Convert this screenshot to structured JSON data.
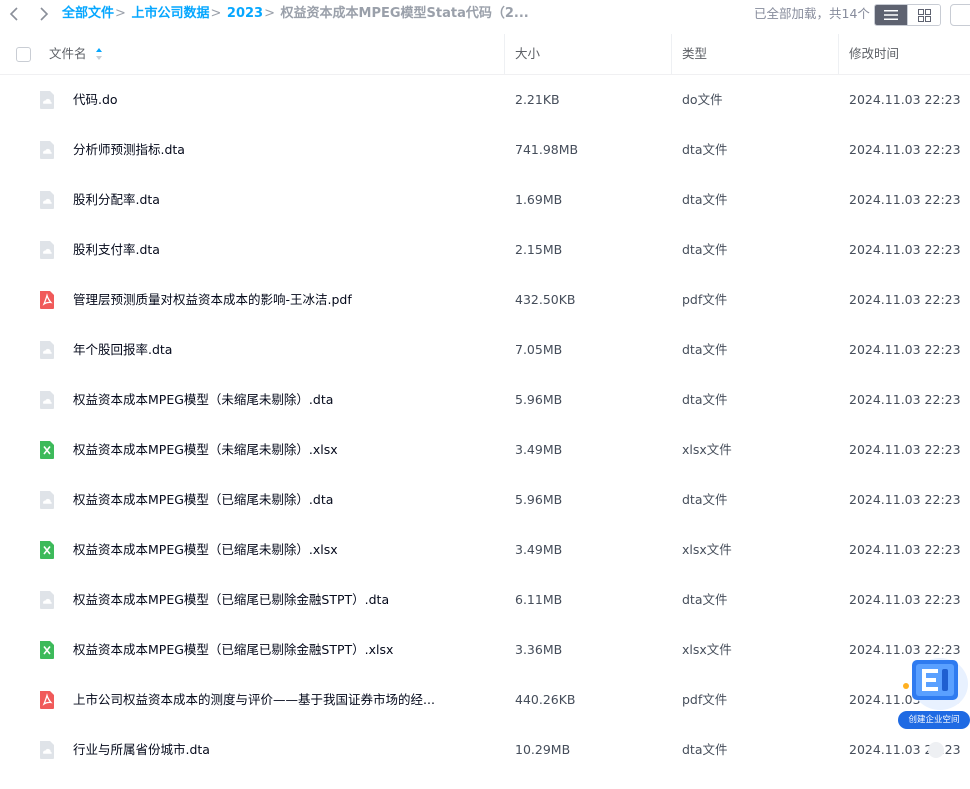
{
  "nav": {
    "back_icon": "chevron-left-icon",
    "forward_icon": "chevron-right-icon"
  },
  "breadcrumb": {
    "items": [
      "全部文件",
      "上市公司数据",
      "2023"
    ],
    "current": "权益资本成本MPEG模型Stata代码（2...",
    "separator": ">"
  },
  "status": {
    "loaded_text": "已全部加载，共14个"
  },
  "view": {
    "active": "list",
    "list_icon": "list-view-icon",
    "grid_icon": "grid-view-icon"
  },
  "table": {
    "headers": {
      "name": "文件名",
      "size": "大小",
      "type": "类型",
      "modified": "修改时间"
    },
    "sort": {
      "column": "name",
      "direction": "asc"
    },
    "rows": [
      {
        "icon": "file-icon",
        "name": "代码.do",
        "size": "2.21KB",
        "type": "do文件",
        "modified": "2024.11.03 22:23"
      },
      {
        "icon": "file-icon",
        "name": "分析师预测指标.dta",
        "size": "741.98MB",
        "type": "dta文件",
        "modified": "2024.11.03 22:23"
      },
      {
        "icon": "file-icon",
        "name": "股利分配率.dta",
        "size": "1.69MB",
        "type": "dta文件",
        "modified": "2024.11.03 22:23"
      },
      {
        "icon": "file-icon",
        "name": "股利支付率.dta",
        "size": "2.15MB",
        "type": "dta文件",
        "modified": "2024.11.03 22:23"
      },
      {
        "icon": "pdf-icon",
        "name": "管理层预测质量对权益资本成本的影响-王冰洁.pdf",
        "size": "432.50KB",
        "type": "pdf文件",
        "modified": "2024.11.03 22:23"
      },
      {
        "icon": "file-icon",
        "name": "年个股回报率.dta",
        "size": "7.05MB",
        "type": "dta文件",
        "modified": "2024.11.03 22:23"
      },
      {
        "icon": "file-icon",
        "name": "权益资本成本MPEG模型（未缩尾未剔除）.dta",
        "size": "5.96MB",
        "type": "dta文件",
        "modified": "2024.11.03 22:23"
      },
      {
        "icon": "excel-icon",
        "name": "权益资本成本MPEG模型（未缩尾未剔除）.xlsx",
        "size": "3.49MB",
        "type": "xlsx文件",
        "modified": "2024.11.03 22:23"
      },
      {
        "icon": "file-icon",
        "name": "权益资本成本MPEG模型（已缩尾未剔除）.dta",
        "size": "5.96MB",
        "type": "dta文件",
        "modified": "2024.11.03 22:23"
      },
      {
        "icon": "excel-icon",
        "name": "权益资本成本MPEG模型（已缩尾未剔除）.xlsx",
        "size": "3.49MB",
        "type": "xlsx文件",
        "modified": "2024.11.03 22:23"
      },
      {
        "icon": "file-icon",
        "name": "权益资本成本MPEG模型（已缩尾已剔除金融STPT）.dta",
        "size": "6.11MB",
        "type": "dta文件",
        "modified": "2024.11.03 22:23"
      },
      {
        "icon": "excel-icon",
        "name": "权益资本成本MPEG模型（已缩尾已剔除金融STPT）.xlsx",
        "size": "3.36MB",
        "type": "xlsx文件",
        "modified": "2024.11.03 22:23"
      },
      {
        "icon": "pdf-icon",
        "name": "上市公司权益资本成本的测度与评价——基于我国证券市场的经...",
        "size": "440.26KB",
        "type": "pdf文件",
        "modified": "2024.11.03 22:23"
      },
      {
        "icon": "file-icon",
        "name": "行业与所属省份城市.dta",
        "size": "10.29MB",
        "type": "dta文件",
        "modified": "2024.11.03 22:23"
      }
    ]
  },
  "promo": {
    "label": "创建企业空间"
  },
  "colors": {
    "accent": "#06a7ff",
    "pdf": "#f05a5a",
    "excel": "#3dba5b",
    "generic_file": "#dfe3e8"
  }
}
